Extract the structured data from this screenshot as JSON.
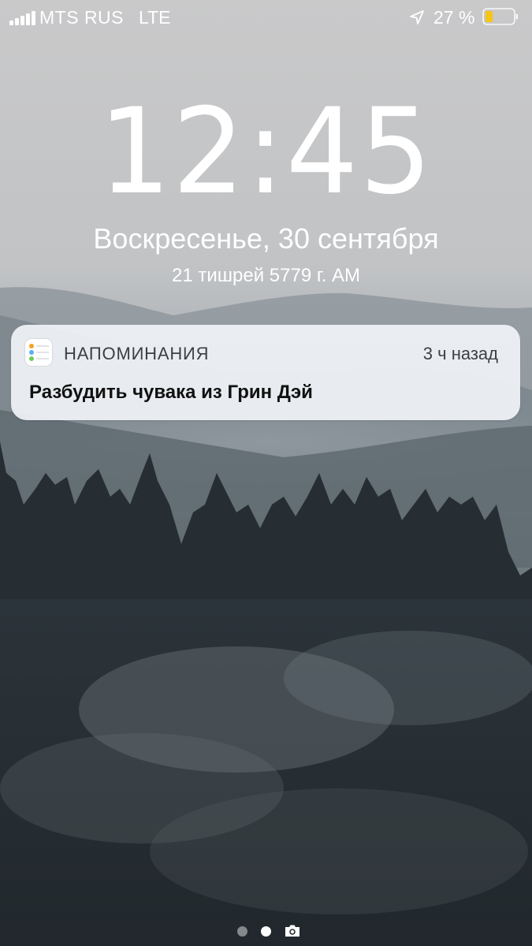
{
  "status_bar": {
    "carrier": "MTS RUS",
    "network": "LTE",
    "battery_percent_label": "27 %",
    "battery_level": 0.27,
    "signal_bars": 5,
    "icons": [
      "signal-icon",
      "location-arrow-icon",
      "battery-icon"
    ],
    "battery_color": "#f5c518"
  },
  "lock_screen": {
    "time": "12:45",
    "date": "Воскресенье, 30 сентября",
    "alt_calendar_date": "21 тишрей 5779 г. AM"
  },
  "notification": {
    "app_name": "НАПОМИНАНИЯ",
    "time_ago": "3 ч назад",
    "message": "Разбудить чувака из Грин Дэй",
    "icon": "reminders-app-icon"
  },
  "page_indicator": {
    "pages": 2,
    "current_page": 2,
    "icon": "camera-icon"
  }
}
